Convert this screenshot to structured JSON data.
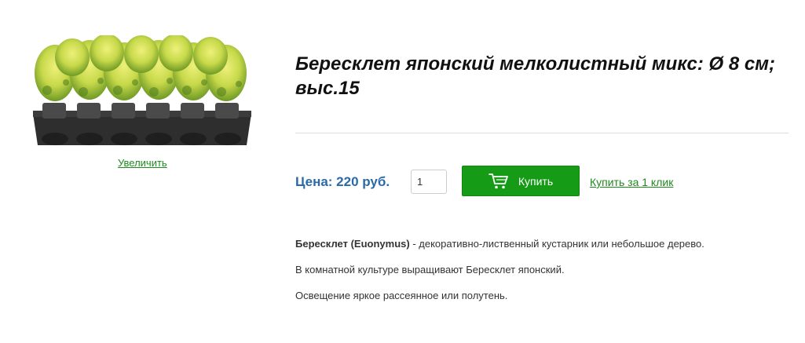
{
  "product": {
    "title": "Бересклет японский мелколистный микс: Ø 8 см; выс.15",
    "zoom_label": "Увеличить",
    "price_label": "Цена: 220 руб.",
    "quantity": "1",
    "buy_label": "Купить",
    "one_click_label": "Купить за 1 клик"
  },
  "description": {
    "line1_bold": "Бересклет (Euonymus)",
    "line1_rest": " - декоративно-лиственный кустарник или небольшое дерево.",
    "line2": "В комнатной культуре выращивают Бересклет японский.",
    "line3": "Освещение яркое рассеянное или полутень."
  },
  "icons": {
    "buy": "shopping-cart-icon",
    "image": "plant-tray-image"
  },
  "colors": {
    "buy_button": "#159b15",
    "price": "#2a6aa8",
    "link": "#1e8a1e"
  }
}
